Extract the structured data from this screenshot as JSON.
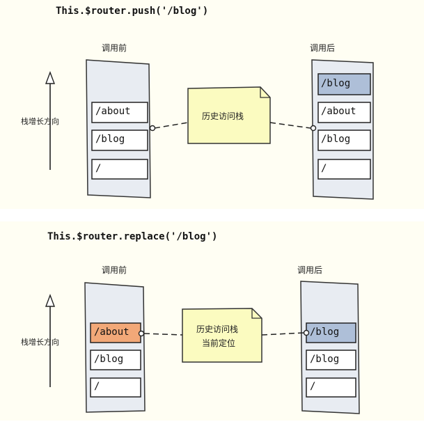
{
  "push_section": {
    "code": "This.$router.push('/blog')",
    "before_label": "调用前",
    "after_label": "调用后",
    "direction_label": "栈增长方向",
    "history_note": "历史访问栈",
    "before_stack": [
      "/about",
      "/blog",
      "/"
    ],
    "after_stack": [
      "/blog",
      "/about",
      "/blog",
      "/"
    ]
  },
  "replace_section": {
    "code": "This.$router.replace('/blog')",
    "before_label": "调用前",
    "after_label": "调用后",
    "direction_label": "栈增长方向",
    "history_note_line1": "历史访问栈",
    "history_note_line2": "当前定位",
    "before_stack": [
      "/about",
      "/blog",
      "/"
    ],
    "after_stack": [
      "/blog",
      "/blog",
      "/"
    ]
  },
  "colors": {
    "panel_bg": "#fffef3",
    "stack_bg": "#e8ecf2",
    "highlight_blue": "#aebfd8",
    "highlight_orange": "#f2a878",
    "note_bg": "#fbfbc0"
  }
}
